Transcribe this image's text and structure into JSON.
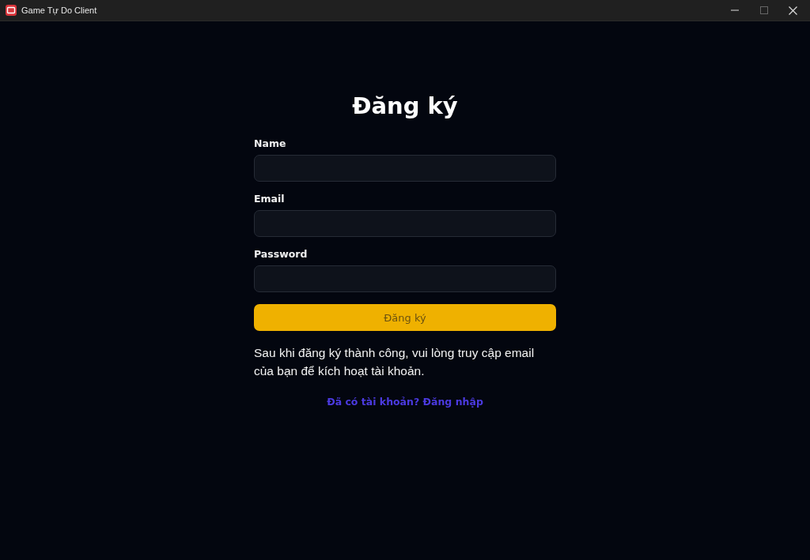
{
  "window": {
    "title": "Game Tự Do Client"
  },
  "form": {
    "title": "Đăng ký",
    "fields": [
      {
        "label": "Name"
      },
      {
        "label": "Email"
      },
      {
        "label": "Password"
      }
    ],
    "submit": {
      "label": "Đăng ký",
      "disabled": true
    },
    "note": "Sau khi đăng ký thành công, vui lòng truy cập email của bạn để kích hoạt tài khoản.",
    "login_link": "Đã có tài khoản? Đăng nhập"
  }
}
